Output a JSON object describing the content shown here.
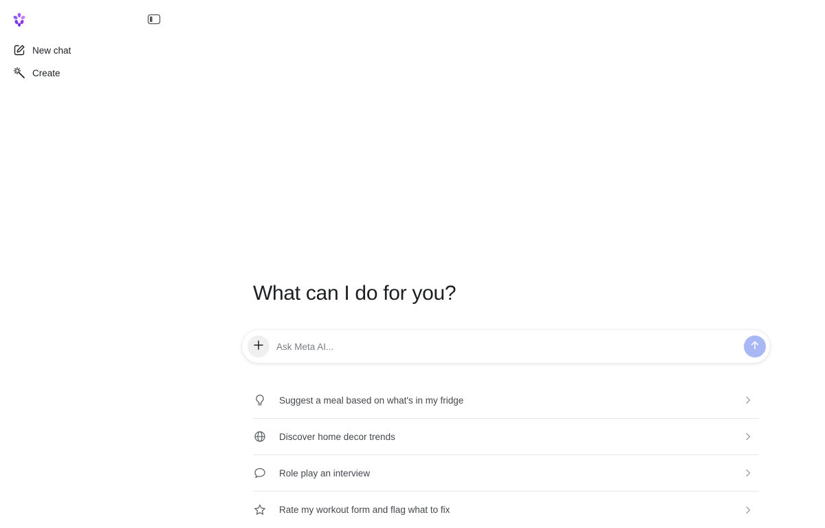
{
  "sidebar": {
    "logo_icon": "meta-ai-logo-icon",
    "toggle_icon": "sidebar-toggle-icon",
    "items": [
      {
        "label": "New chat",
        "icon": "edit-icon"
      },
      {
        "label": "Create",
        "icon": "magic-wand-icon"
      }
    ]
  },
  "main": {
    "headline": "What can I do for you?",
    "composer": {
      "placeholder": "Ask Meta AI...",
      "value": "",
      "attach_icon": "plus-icon",
      "send_icon": "arrow-up-icon"
    },
    "suggestions": [
      {
        "label": "Suggest a meal based on what's in my fridge",
        "icon": "lightbulb-icon"
      },
      {
        "label": "Discover home decor trends",
        "icon": "globe-icon"
      },
      {
        "label": "Role play an interview",
        "icon": "speech-bubble-icon"
      },
      {
        "label": "Rate my workout form and flag what to fix",
        "icon": "star-icon"
      }
    ]
  },
  "colors": {
    "accent_send": "#a9b8f5",
    "logo_purple": "#8b5cf6",
    "divider": "#e4e6ea"
  }
}
